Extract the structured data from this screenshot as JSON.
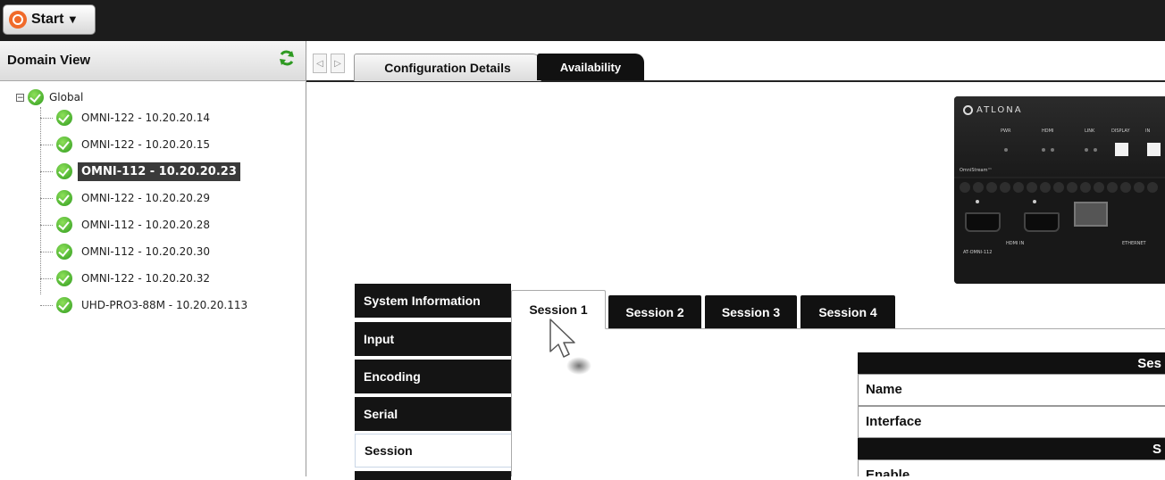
{
  "topbar": {
    "start_label": "Start"
  },
  "left_panel": {
    "title": "Domain View",
    "tree": {
      "root_label": "Global",
      "items": [
        {
          "label": "OMNI-122 - 10.20.20.14",
          "selected": false
        },
        {
          "label": "OMNI-122 - 10.20.20.15",
          "selected": false
        },
        {
          "label": "OMNI-112 - 10.20.20.23",
          "selected": true
        },
        {
          "label": "OMNI-122 - 10.20.20.29",
          "selected": false
        },
        {
          "label": "OMNI-112 - 10.20.20.28",
          "selected": false
        },
        {
          "label": "OMNI-112 - 10.20.20.30",
          "selected": false
        },
        {
          "label": "OMNI-122 - 10.20.20.32",
          "selected": false
        },
        {
          "label": "UHD-PRO3-88M - 10.20.20.113",
          "selected": false
        }
      ]
    }
  },
  "main_tabs": [
    {
      "label": "Configuration Details",
      "active": false
    },
    {
      "label": "Availability",
      "active": true
    }
  ],
  "device": {
    "brand": "ATLONA",
    "series": "OmniStream™",
    "model": "AT-OMNI-112",
    "front_labels": {
      "pwr": "PWR",
      "hdmi": "HDMI",
      "link": "LINK",
      "display": "DISPLAY",
      "input": "IN"
    },
    "rear_labels": {
      "hdmi_in": "HDMI IN",
      "ethernet": "ETHERNET"
    }
  },
  "side_menu": [
    {
      "label": "System Information",
      "active": false
    },
    {
      "label": "Input",
      "active": false
    },
    {
      "label": "Encoding",
      "active": false
    },
    {
      "label": "Serial",
      "active": false
    },
    {
      "label": "Session",
      "active": true
    }
  ],
  "session_tabs": [
    {
      "label": "Session 1",
      "active": true
    },
    {
      "label": "Session 2",
      "active": false
    },
    {
      "label": "Session 3",
      "active": false
    },
    {
      "label": "Session 4",
      "active": false
    }
  ],
  "session_table": {
    "header_1": "Ses",
    "row_name": "Name",
    "row_interface": "Interface",
    "header_2": "S",
    "row_enable": "Enable"
  },
  "colors": {
    "accent_orange": "#f06a2a",
    "ok_green": "#2f9b1e",
    "dark_bar": "#1c1c1c",
    "tab_active": "#111111"
  }
}
